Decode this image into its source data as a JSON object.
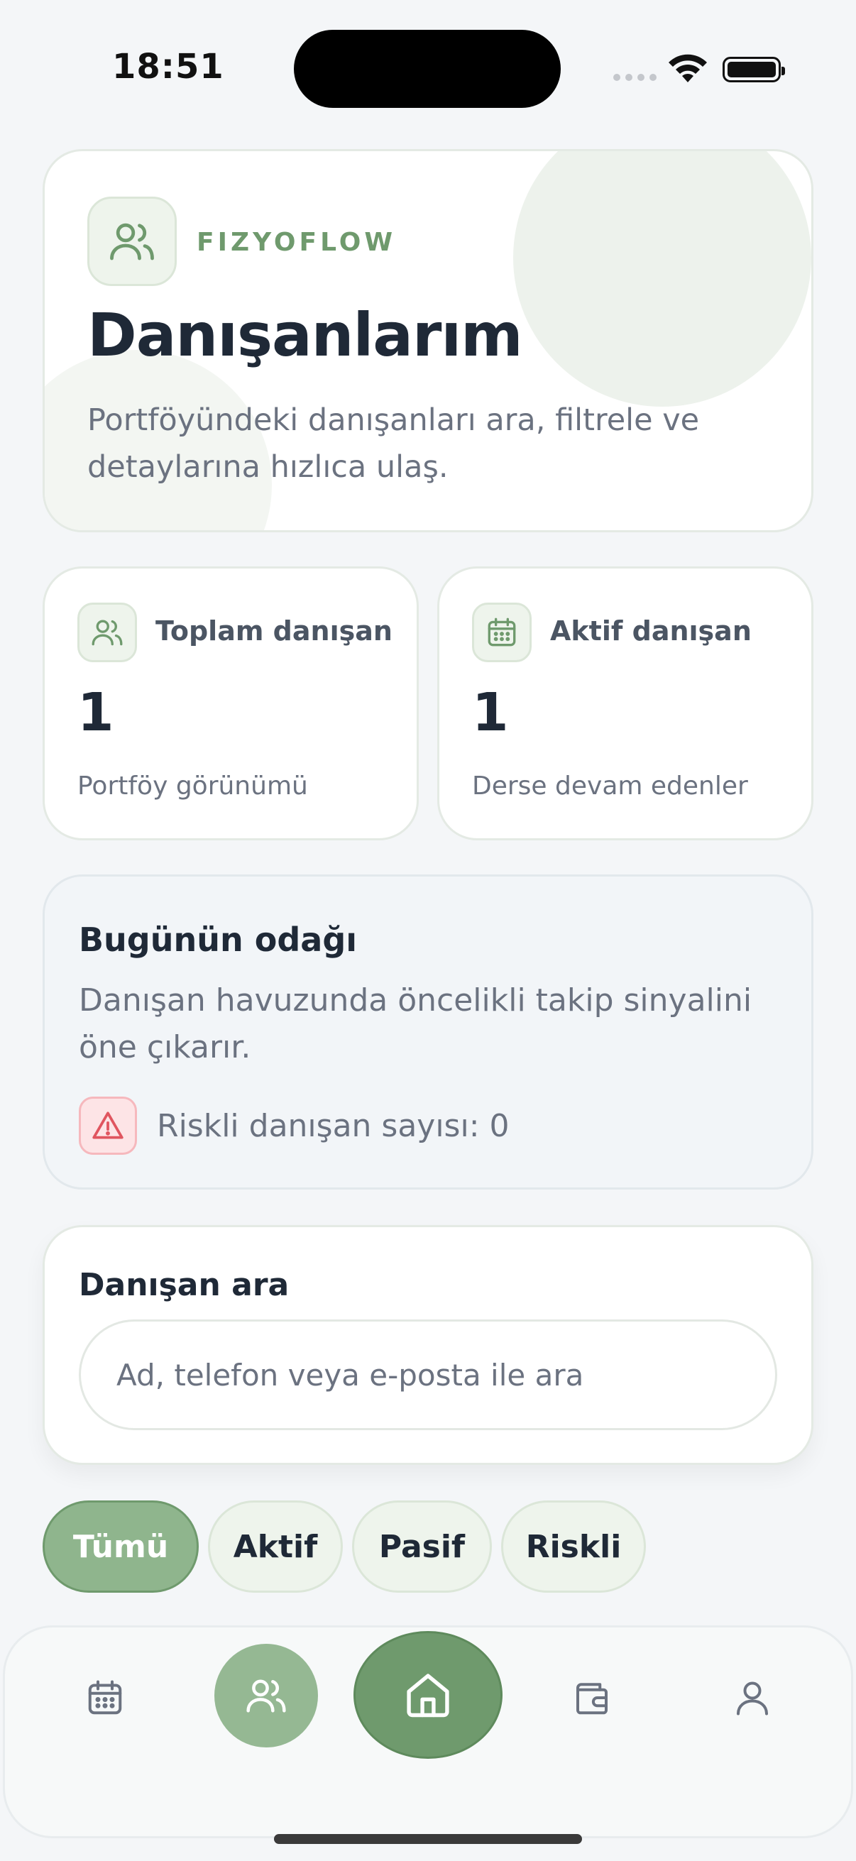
{
  "status_bar": {
    "time": "18:51"
  },
  "hero": {
    "brand": "FIZYOFLOW",
    "title": "Danışanlarım",
    "subtitle": "Portföyündeki danışanları ara, filtrele ve detaylarına hızlıca ulaş.",
    "icon": "users-icon"
  },
  "stats": [
    {
      "label": "Toplam danışan",
      "value": "1",
      "footer": "Portföy görünümü",
      "icon": "users-icon"
    },
    {
      "label": "Aktif danışan",
      "value": "1",
      "footer": "Derse devam edenler",
      "icon": "calendar-icon"
    }
  ],
  "focus": {
    "title": "Bugünün odağı",
    "description": "Danışan havuzunda öncelikli takip sinyalini öne çıkarır.",
    "risk_text": "Riskli danışan sayısı: 0",
    "icon": "warning-icon"
  },
  "search": {
    "title": "Danışan ara",
    "placeholder": "Ad, telefon veya e-posta ile ara",
    "value": ""
  },
  "filters": [
    {
      "label": "Tümü",
      "active": true
    },
    {
      "label": "Aktif",
      "active": false
    },
    {
      "label": "Pasif",
      "active": false
    },
    {
      "label": "Riskli",
      "active": false
    }
  ],
  "bottom_nav": {
    "items": [
      "calendar-icon",
      "users-icon",
      "home-icon",
      "wallet-icon",
      "profile-icon"
    ],
    "active": "users-icon"
  },
  "colors": {
    "brand_green": "#6f9a6d",
    "light_green": "#eef4ec",
    "danger": "#e0555f",
    "text_dark": "#1f2937",
    "text_muted": "#6b7280"
  }
}
